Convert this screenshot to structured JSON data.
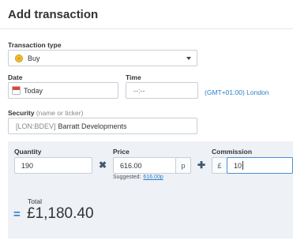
{
  "header": {
    "title": "Add transaction"
  },
  "transaction_type": {
    "label": "Transaction type",
    "value": "Buy",
    "icon": "coin-icon"
  },
  "date": {
    "label": "Date",
    "value": "Today",
    "icon": "calendar-icon"
  },
  "time": {
    "label": "Time",
    "placeholder": "--:--",
    "timezone": "(GMT+01:00) London"
  },
  "security": {
    "label": "Security",
    "hint": "(name or ticker)",
    "ticker": "[LON:BDEV]",
    "name": "Barratt Developments"
  },
  "quantity": {
    "label": "Quantity",
    "value": "190"
  },
  "price": {
    "label": "Price",
    "value": "616.00",
    "unit": "p",
    "suggested_label": "Suggested:",
    "suggested_value": "616.00p"
  },
  "commission": {
    "label": "Commission",
    "currency": "£",
    "value": "10"
  },
  "operators": {
    "multiply": "✖",
    "plus": "✚",
    "equals": "="
  },
  "total": {
    "label": "Total",
    "value": "£1,180.40"
  },
  "colors": {
    "accent": "#2b7fc4",
    "panel_bg": "#eef1f6",
    "border": "#c9ced6"
  }
}
